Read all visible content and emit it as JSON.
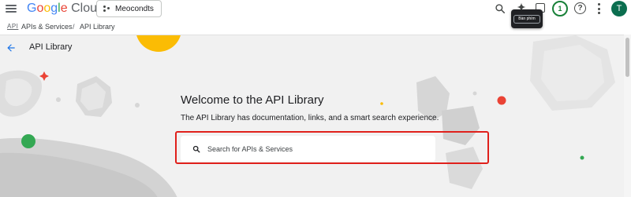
{
  "header": {
    "logo_text": "Google Cloud",
    "project_name": "Meocondts",
    "tooltip": "Bàn phím",
    "notification_count": "1",
    "help_glyph": "?",
    "avatar_letter": "T"
  },
  "breadcrumb": {
    "api_icon": "API",
    "items": [
      "APIs & Services",
      "API Library"
    ],
    "separator": "/"
  },
  "page": {
    "title": "API Library",
    "welcome": "Welcome to the API Library",
    "description": "The API Library has documentation, links, and a smart search experience."
  },
  "search": {
    "placeholder": "Search for APIs & Services",
    "value": ""
  },
  "colors": {
    "highlight": "#e0201b",
    "accent_blue": "#1a73e8",
    "avatar": "#0b6e4f",
    "badge_green": "#188038"
  }
}
